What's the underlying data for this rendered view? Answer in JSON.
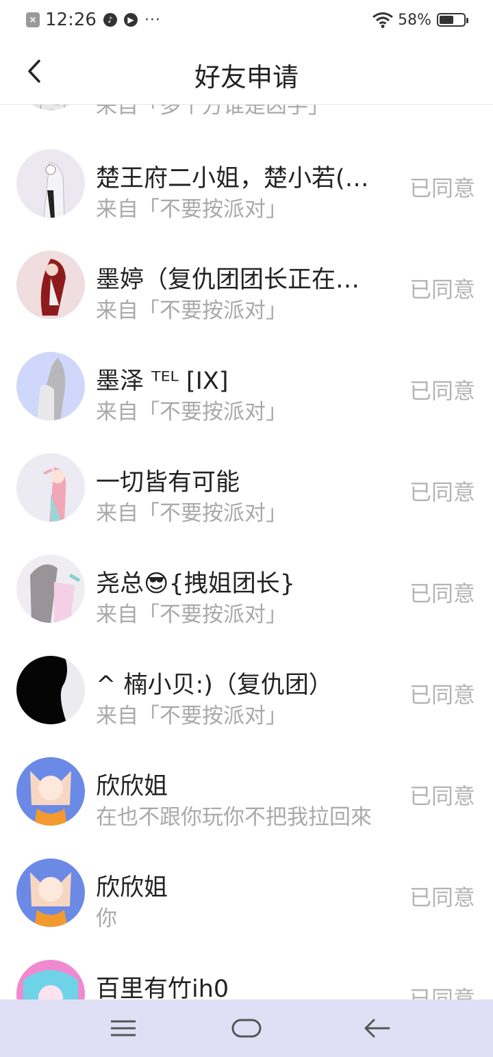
{
  "status_bar": {
    "time": "12:26",
    "dots": "···",
    "battery": "58%",
    "battery_level": 0.58
  },
  "header": {
    "title": "好友申请"
  },
  "requests": [
    {
      "name": "",
      "source": "来自「多个方谁是凶手」",
      "status": "",
      "avatar": "a0"
    },
    {
      "name": "楚王府二小姐，楚小若(沐…",
      "source": "来自「不要按派对」",
      "status": "已同意",
      "avatar": "a1"
    },
    {
      "name": "墨婷（复仇团团长正在…",
      "source": "来自「不要按派对」",
      "status": "已同意",
      "avatar": "a2"
    },
    {
      "name": "墨泽 ᵀᴱᴸ [IX]",
      "source": "来自「不要按派对」",
      "status": "已同意",
      "avatar": "a3"
    },
    {
      "name": "一切皆有可能",
      "source": "来自「不要按派对」",
      "status": "已同意",
      "avatar": "a4"
    },
    {
      "name": "尧总😎{拽姐团长}",
      "source": "来自「不要按派对」",
      "status": "已同意",
      "avatar": "a5"
    },
    {
      "name": "^ 楠小贝:)（复仇团）",
      "source": "来自「不要按派对」",
      "status": "已同意",
      "avatar": "a6"
    },
    {
      "name": "欣欣姐",
      "source": "在也不跟你玩你不把我拉回來",
      "status": "已同意",
      "avatar": "a7"
    },
    {
      "name": "欣欣姐",
      "source": "你",
      "status": "已同意",
      "avatar": "a7"
    },
    {
      "name": "百里有竹ih0",
      "source": "",
      "status": "已同意",
      "avatar": "a9"
    }
  ],
  "nav": {
    "icons": [
      "menu-icon",
      "home-icon",
      "back-arrow-icon"
    ]
  },
  "colors": {
    "nav_bg": "#dfe0f5",
    "subtext": "#a9a9a9",
    "status": "#b3b3b3"
  }
}
